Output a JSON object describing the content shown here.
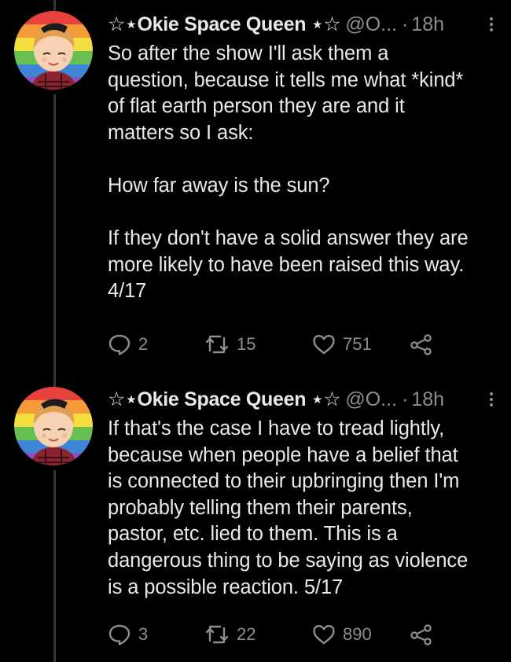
{
  "tweets": [
    {
      "display_name": "☆⋆Okie Space Queen ⋆☆",
      "handle": "@O...",
      "separator": "·",
      "time": "18h",
      "body": "So after the show I'll ask them a\nquestion, because it tells me what *kind*\nof flat earth person they are and it\nmatters so I ask:\n\nHow far away is the sun?\n\nIf they don't have a solid answer they are\nmore likely to have been raised this way.\n4/17",
      "replies": "2",
      "retweets": "15",
      "likes": "751"
    },
    {
      "display_name": "☆⋆Okie Space Queen ⋆☆",
      "handle": "@O...",
      "separator": "·",
      "time": "18h",
      "body": "If that's the case I have to tread lightly,\nbecause when people have a belief that\nis connected to their upbringing then I'm\nprobably telling them their parents,\npastor, etc. lied to them. This is a\ndangerous thing to be saying as violence\nis a possible reaction. 5/17",
      "replies": "3",
      "retweets": "22",
      "likes": "890"
    }
  ],
  "icons": {
    "reply": "reply-icon",
    "retweet": "retweet-icon",
    "like": "heart-icon",
    "share": "share-icon",
    "more": "more-vertical-icon"
  },
  "colors": {
    "background": "#000000",
    "text": "#e7e9ea",
    "secondary": "#8b8f94",
    "thread_line": "#333639"
  }
}
